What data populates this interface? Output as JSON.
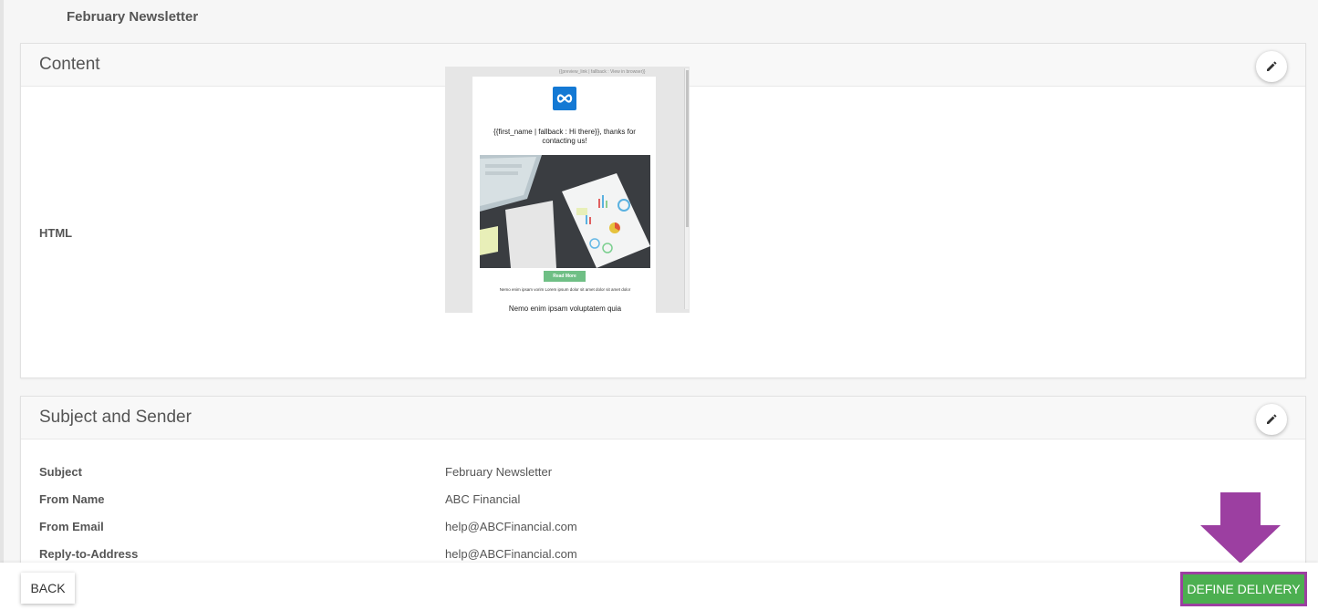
{
  "page": {
    "title": "February Newsletter"
  },
  "content_card": {
    "title": "Content",
    "html_label": "HTML",
    "preview": {
      "top_link": "{{preview_link | fallback : View in browser}}",
      "greeting": "{{first_name | fallback : Hi there}}, thanks for contacting us!",
      "button": "Read More",
      "small_text": "Nemo enim ipsam vorim Lorem ipsum dolor sit amet dolor sit amet dolor",
      "big_text": "Nemo enim ipsam voluptatem quia"
    }
  },
  "sender_card": {
    "title": "Subject and Sender",
    "rows": [
      {
        "label": "Subject",
        "value": "February Newsletter"
      },
      {
        "label": "From Name",
        "value": "ABC Financial"
      },
      {
        "label": "From Email",
        "value": "help@ABCFinancial.com"
      },
      {
        "label": "Reply-to-Address",
        "value": "help@ABCFinancial.com"
      }
    ]
  },
  "footer": {
    "back_label": "BACK",
    "define_label": "DEFINE DELIVERY"
  },
  "colors": {
    "accent_green": "#4caf50",
    "highlight_purple": "#9c3fa1",
    "logo_blue": "#1479d4"
  }
}
